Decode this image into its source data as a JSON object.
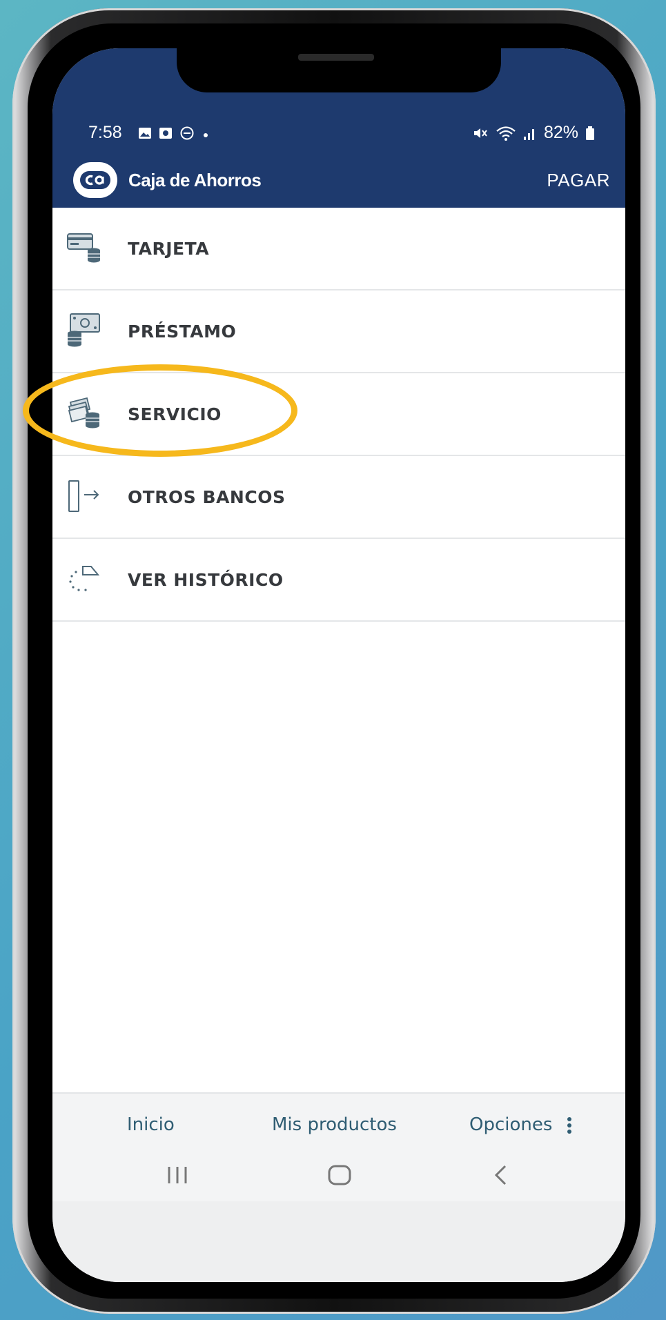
{
  "status_bar": {
    "time": "7:58",
    "battery": "82%"
  },
  "header": {
    "brand_name": "Caja de Ahorros",
    "action": "PAGAR"
  },
  "menu": {
    "items": [
      {
        "label": "TARJETA",
        "icon": "card-stack-icon"
      },
      {
        "label": "PRÉSTAMO",
        "icon": "loan-cash-icon"
      },
      {
        "label": "SERVICIO",
        "icon": "service-bills-icon"
      },
      {
        "label": "OTROS BANCOS",
        "icon": "transfer-arrow-icon"
      },
      {
        "label": "VER HISTÓRICO",
        "icon": "history-icon"
      }
    ]
  },
  "bottom_nav": {
    "tabs": [
      {
        "label": "Inicio"
      },
      {
        "label": "Mis productos"
      },
      {
        "label": "Opciones"
      }
    ]
  },
  "colors": {
    "header_bg": "#1e3a6e",
    "highlight": "#f6b81c",
    "nav_text": "#2f5d73",
    "item_text": "#36393d"
  }
}
